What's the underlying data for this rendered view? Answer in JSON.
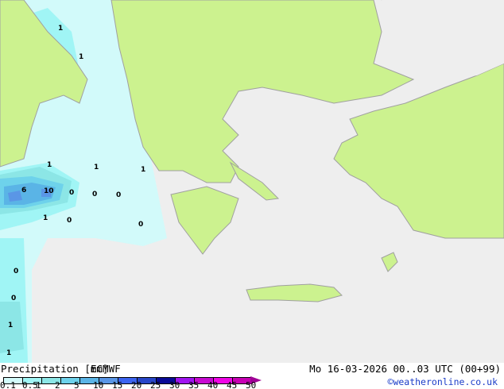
{
  "title": "Precipitation [mm]",
  "model": "ECMWF",
  "datetime": "Mo 16-03-2026 00..03 UTC (00+99)",
  "copyright": "©weatheronline.co.uk",
  "legend": {
    "ticks": [
      "0.1",
      "0.5",
      "1",
      "2",
      "5",
      "10",
      "15",
      "20",
      "25",
      "30",
      "35",
      "40",
      "45",
      "50"
    ],
    "colors": [
      "#d2fafa",
      "#a0f5f5",
      "#8ce6e6",
      "#6ed2eb",
      "#5ab4e6",
      "#5a96e6",
      "#3c64f0",
      "#2846c8",
      "#0a0a96",
      "#a014f0",
      "#c80ad2",
      "#f005e6",
      "#c800b4"
    ],
    "overflow_color": "#a00096"
  },
  "colors": {
    "land": "#ccf28f",
    "sea": "#eeeeee",
    "border": "#a0a0a0"
  },
  "map_labels": [
    "1",
    "1",
    "1",
    "1",
    "1",
    "6",
    "10",
    "0",
    "0",
    "0",
    "1",
    "0",
    "0",
    "0",
    "0",
    "1",
    "1"
  ]
}
